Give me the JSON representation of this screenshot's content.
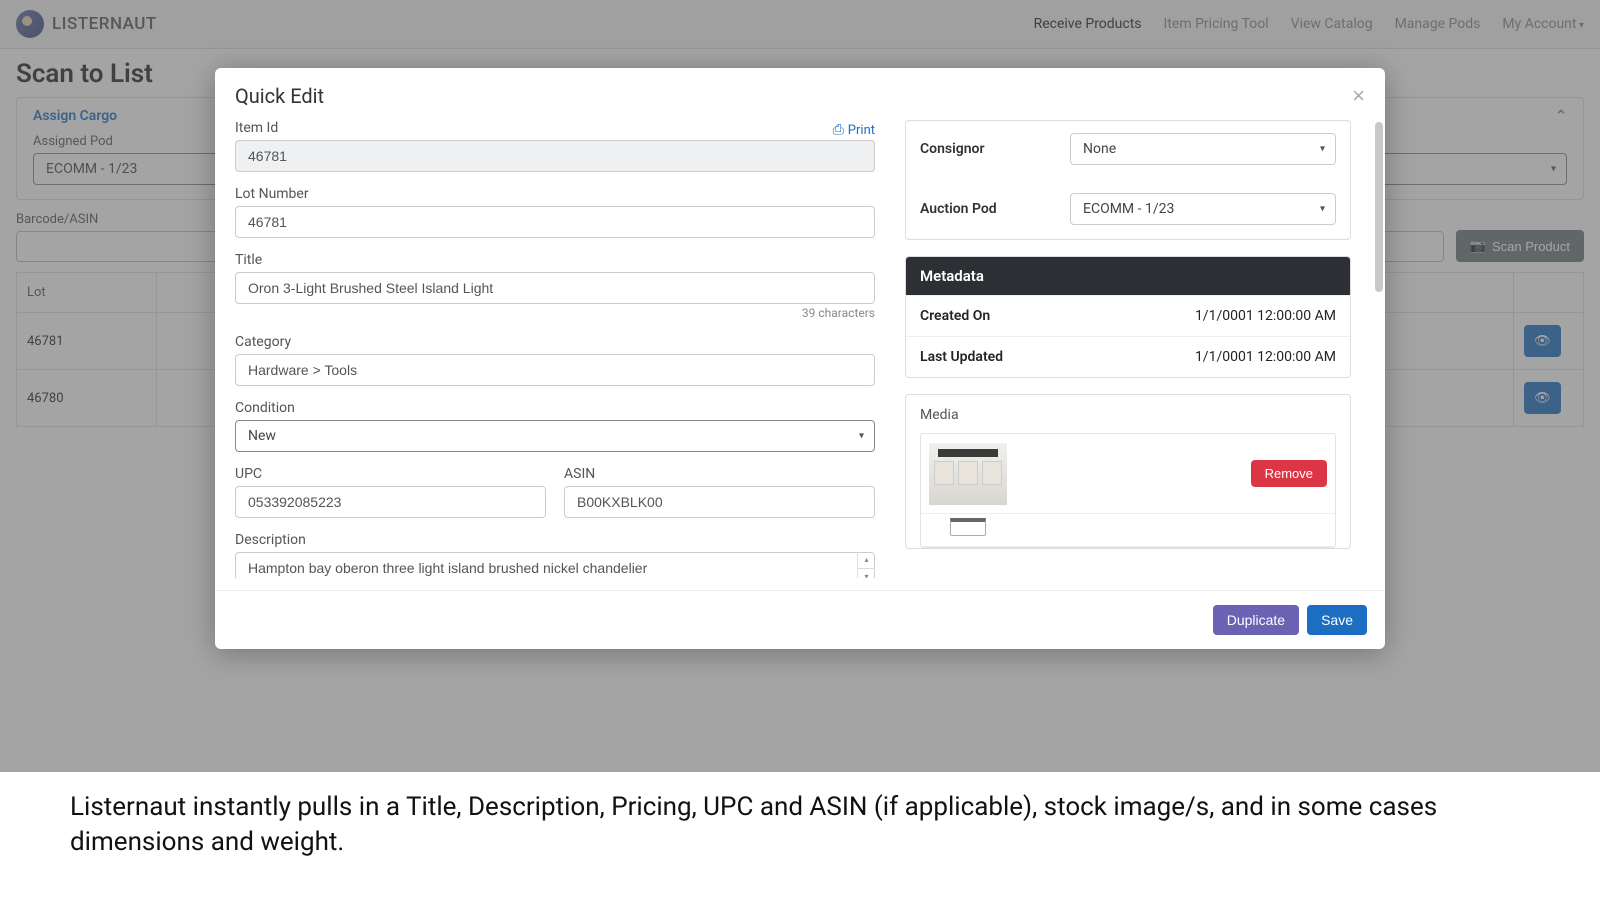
{
  "brand": {
    "name": "LISTERNAUT"
  },
  "nav": {
    "items": [
      {
        "label": "Receive Products",
        "active": true
      },
      {
        "label": "Item Pricing Tool",
        "active": false
      },
      {
        "label": "View Catalog",
        "active": false
      },
      {
        "label": "Manage Pods",
        "active": false
      },
      {
        "label": "My Account",
        "active": false,
        "caret": true
      }
    ]
  },
  "page": {
    "title": "Scan to List",
    "assign_cargo": "Assign Cargo",
    "assigned_pod_label": "Assigned Pod",
    "assigned_pod_value": "ECOMM - 1/23",
    "barcode_label": "Barcode/ASIN",
    "scan_button": "Scan Product",
    "table": {
      "lot_header": "Lot",
      "rows": [
        {
          "lot": "46781"
        },
        {
          "lot": "46780"
        }
      ]
    }
  },
  "modal": {
    "title": "Quick Edit",
    "print": "Print",
    "labels": {
      "item_id": "Item Id",
      "lot_number": "Lot Number",
      "title": "Title",
      "category": "Category",
      "condition": "Condition",
      "upc": "UPC",
      "asin": "ASIN",
      "description": "Description",
      "consignor": "Consignor",
      "auction_pod": "Auction Pod",
      "metadata": "Metadata",
      "created_on": "Created On",
      "last_updated": "Last Updated",
      "media": "Media"
    },
    "values": {
      "item_id": "46781",
      "lot_number": "46781",
      "title": "Oron 3-Light Brushed Steel Island Light",
      "char_count": "39 characters",
      "category": "Hardware > Tools",
      "condition": "New",
      "upc": "053392085223",
      "asin": "B00KXBLK00",
      "description": "Hampton bay oberon three light island brushed nickel chandelier",
      "consignor": "None",
      "auction_pod": "ECOMM - 1/23",
      "created_on": "1/1/0001 12:00:00 AM",
      "last_updated": "1/1/0001 12:00:00 AM"
    },
    "buttons": {
      "remove": "Remove",
      "duplicate": "Duplicate",
      "save": "Save"
    }
  },
  "caption": "Listernaut instantly pulls in a Title, Description, Pricing, UPC and ASIN (if applicable), stock image/s, and in some cases dimensions and weight."
}
